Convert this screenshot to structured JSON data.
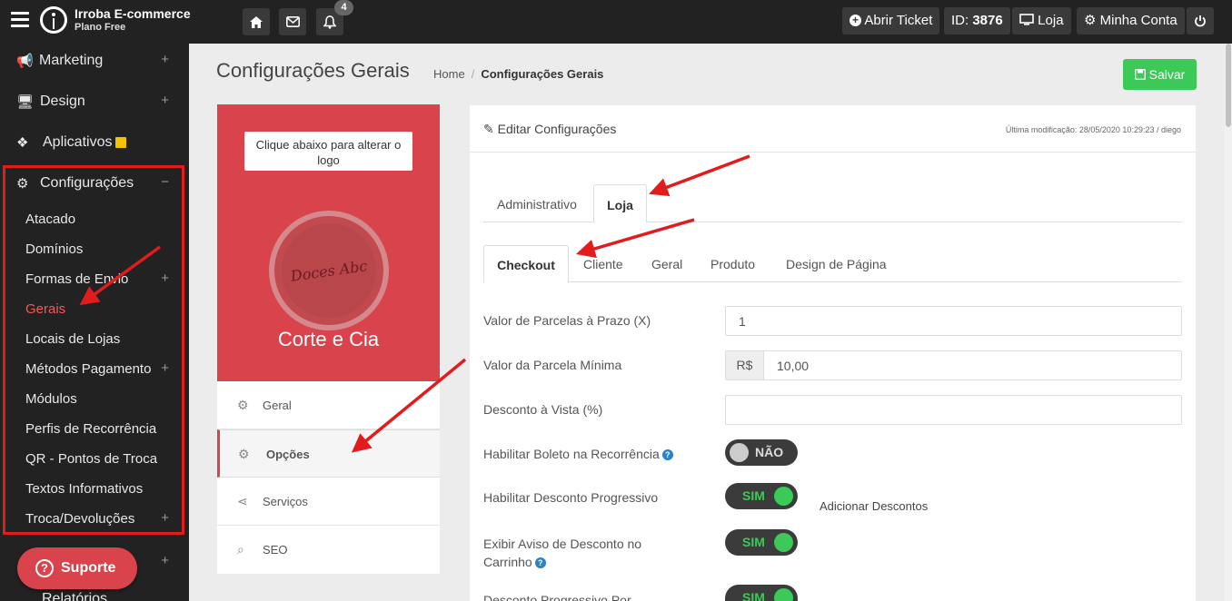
{
  "topbar": {
    "brand_name": "Irroba E-commerce",
    "brand_plan": "Plano Free",
    "notifications_count": "4",
    "open_ticket": "Abrir Ticket",
    "id_label": "ID:",
    "id_value": "3876",
    "store_label": "Loja",
    "account_label": "Minha Conta"
  },
  "sidebar": {
    "items": [
      {
        "label": "Marketing",
        "icon": "megaphone-icon"
      },
      {
        "label": "Design",
        "icon": "monitor-icon"
      },
      {
        "label": "Aplicativos",
        "icon": "cubes-icon"
      },
      {
        "label": "Configurações",
        "icon": "gears-icon"
      }
    ],
    "sub_items": [
      "Atacado",
      "Domínios",
      "Formas de Envio",
      "Gerais",
      "Locais de Lojas",
      "Métodos Pagamento",
      "Módulos",
      "Perfis de Recorrência",
      "QR - Pontos de Troca",
      "Textos Informativos",
      "Troca/Devoluções"
    ],
    "bottom_partial": "Relatórios",
    "support_label": "Suporte"
  },
  "header": {
    "title": "Configurações Gerais",
    "breadcrumb_home": "Home",
    "breadcrumb_current": "Configurações Gerais",
    "save_label": "Salvar"
  },
  "store_card": {
    "change_logo": "Clique abaixo para alterar o logo",
    "logo_text": "Doces Abc",
    "store_name": "Corte e Cia",
    "menu": [
      {
        "label": "Geral",
        "icon": "gear-icon"
      },
      {
        "label": "Opções",
        "icon": "gears-icon"
      },
      {
        "label": "Serviços",
        "icon": "share-icon"
      },
      {
        "label": "SEO",
        "icon": "search-icon"
      }
    ]
  },
  "panel": {
    "title": "Editar Configurações",
    "last_modified": "Última modificação: 28/05/2020 10:29:23 / diego",
    "tabs": [
      "Administrativo",
      "Loja"
    ],
    "subtabs": [
      "Checkout",
      "Cliente",
      "Geral",
      "Produto",
      "Design de Página"
    ],
    "fields": {
      "parcelas_label": "Valor de Parcelas à Prazo (X)",
      "parcelas_value": "1",
      "parcela_min_label": "Valor da Parcela Mínima",
      "currency": "R$",
      "parcela_min_value": "10,00",
      "desconto_vista_label": "Desconto à Vista (%)",
      "desconto_vista_value": "",
      "boleto_label": "Habilitar Boleto na Recorrência",
      "boleto_state": "NÃO",
      "desc_prog_label": "Habilitar Desconto Progressivo",
      "desc_prog_state": "SIM",
      "add_descontos": "Adicionar Descontos",
      "aviso_label": "Exibir Aviso de Desconto no Carrinho",
      "aviso_state": "SIM",
      "prog_por_label": "Desconto Progressivo Por",
      "prog_por_state": "SIM"
    }
  }
}
